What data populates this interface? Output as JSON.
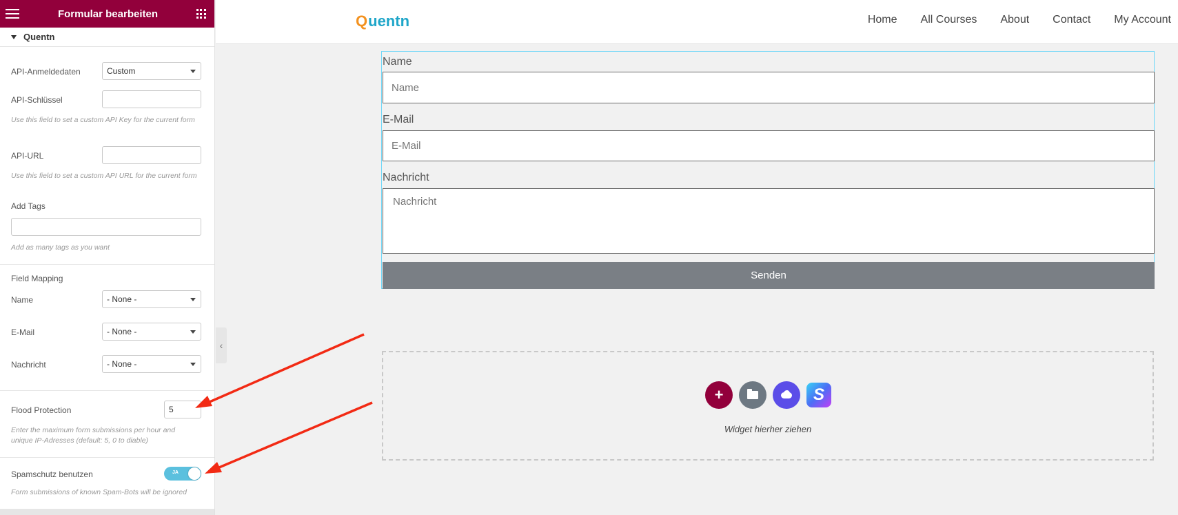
{
  "sidebar": {
    "title": "Formular bearbeiten",
    "section_title": "Quentn",
    "api_credentials": {
      "label": "API-Anmeldedaten",
      "value": "Custom"
    },
    "api_key": {
      "label": "API-Schlüssel",
      "value": "",
      "help": "Use this field to set a custom API Key for the current form"
    },
    "api_url": {
      "label": "API-URL",
      "value": "",
      "help": "Use this field to set a custom API URL for the current form"
    },
    "add_tags": {
      "label": "Add Tags",
      "value": "",
      "help": "Add as many tags as you want"
    },
    "field_mapping": {
      "label": "Field Mapping",
      "rows": [
        {
          "label": "Name",
          "value": "- None -"
        },
        {
          "label": "E-Mail",
          "value": "- None -"
        },
        {
          "label": "Nachricht",
          "value": "- None -"
        }
      ]
    },
    "flood_protection": {
      "label": "Flood Protection",
      "value": "5",
      "help": "Enter the maximum form submissions per hour and unique IP-Adresses (default: 5, 0 to diable)"
    },
    "spam_protection": {
      "label": "Spamschutz benutzen",
      "toggle_text": "JA",
      "enabled": true,
      "help": "Form submissions of known Spam-Bots will be ignored"
    }
  },
  "header": {
    "logo_letter": "Q",
    "logo_rest": "uentn",
    "nav": [
      "Home",
      "All Courses",
      "About",
      "Contact",
      "My Account"
    ]
  },
  "form": {
    "fields": [
      {
        "label": "Name",
        "placeholder": "Name"
      },
      {
        "label": "E-Mail",
        "placeholder": "E-Mail"
      },
      {
        "label": "Nachricht",
        "placeholder": "Nachricht"
      }
    ],
    "submit_label": "Senden"
  },
  "dropzone": {
    "add_symbol": "+",
    "s_letter": "S",
    "text": "Widget hierher ziehen"
  },
  "colors": {
    "brand": "#92003b",
    "toggle_on": "#5bc0de",
    "arrow": "#f22a14",
    "button": "#7a7f85",
    "form_outline": "#71d7f7"
  },
  "icons": [
    "hamburger-icon",
    "grid-icon",
    "caret-down-icon",
    "chevron-left-icon",
    "folder-icon",
    "cloud-icon"
  ]
}
